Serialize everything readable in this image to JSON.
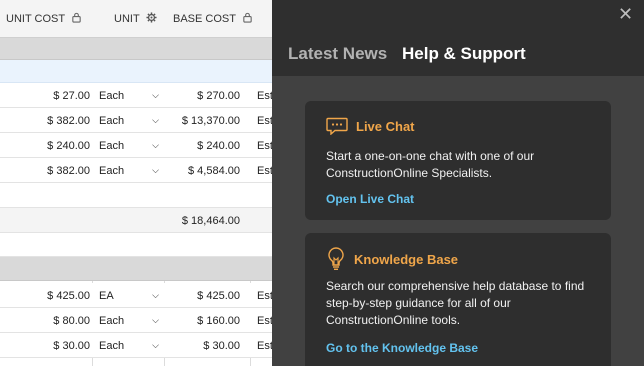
{
  "table": {
    "headers": {
      "unit_cost": "UNIT COST",
      "unit": "UNIT",
      "base_cost": "BASE COST"
    },
    "group1_rows": [
      {
        "unit_cost": "$ 27.00",
        "unit": "Each",
        "base_cost": "$ 270.00",
        "desc": "Est"
      },
      {
        "unit_cost": "$ 382.00",
        "unit": "Each",
        "base_cost": "$ 13,370.00",
        "desc": "Est"
      },
      {
        "unit_cost": "$ 240.00",
        "unit": "Each",
        "base_cost": "$ 240.00",
        "desc": "Est"
      },
      {
        "unit_cost": "$ 382.00",
        "unit": "Each",
        "base_cost": "$ 4,584.00",
        "desc": "Est"
      }
    ],
    "group1_total": "$ 18,464.00",
    "group2_rows": [
      {
        "unit_cost": "$ 425.00",
        "unit": "EA",
        "base_cost": "$ 425.00",
        "desc": "Est"
      },
      {
        "unit_cost": "$ 80.00",
        "unit": "Each",
        "base_cost": "$ 160.00",
        "desc": "Est"
      },
      {
        "unit_cost": "$ 30.00",
        "unit": "Each",
        "base_cost": "$ 30.00",
        "desc": "Est"
      }
    ]
  },
  "panel": {
    "tabs": {
      "latest_news": "Latest News",
      "help_support": "Help & Support"
    },
    "active_tab": "Help & Support",
    "cards": {
      "live_chat": {
        "title": "Live Chat",
        "body": "Start a one-on-one chat with one of our ConstructionOnline Specialists.",
        "link": "Open Live Chat",
        "icon": "chat-bubble-icon"
      },
      "knowledge_base": {
        "title": "Knowledge Base",
        "body": "Search our comprehensive help database to find step-by-step guidance for all of our ConstructionOnline tools.",
        "link": "Go to the Knowledge Base",
        "icon": "lightbulb-icon"
      }
    }
  },
  "colors": {
    "panel_bg": "#414141",
    "card_bg": "#2e2e2e",
    "accent_orange": "#f0a64a",
    "link_blue": "#63c3ef"
  }
}
